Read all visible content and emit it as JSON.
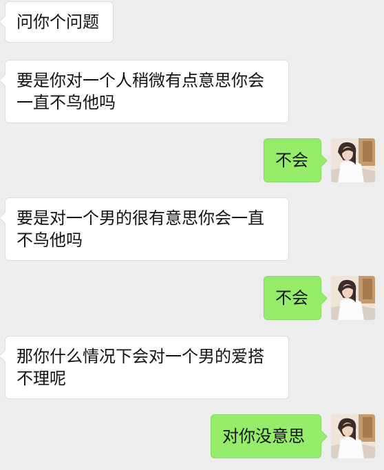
{
  "messages": [
    {
      "side": "left",
      "text": "问你个问题"
    },
    {
      "side": "left",
      "text": "要是你对一个人稍微有点意思你会一直不鸟他吗"
    },
    {
      "side": "right",
      "text": "不会"
    },
    {
      "side": "left",
      "text": "要是对一个男的很有意思你会一直不鸟他吗"
    },
    {
      "side": "right",
      "text": "不会"
    },
    {
      "side": "left",
      "text": "那你什么情况下会对一个男的爱搭不理呢"
    },
    {
      "side": "right",
      "text": "对你没意思"
    }
  ],
  "colors": {
    "background": "#ededed",
    "incoming_bubble": "#ffffff",
    "outgoing_bubble": "#95ec69"
  },
  "icons": {
    "avatar": "user-photo-avatar"
  }
}
